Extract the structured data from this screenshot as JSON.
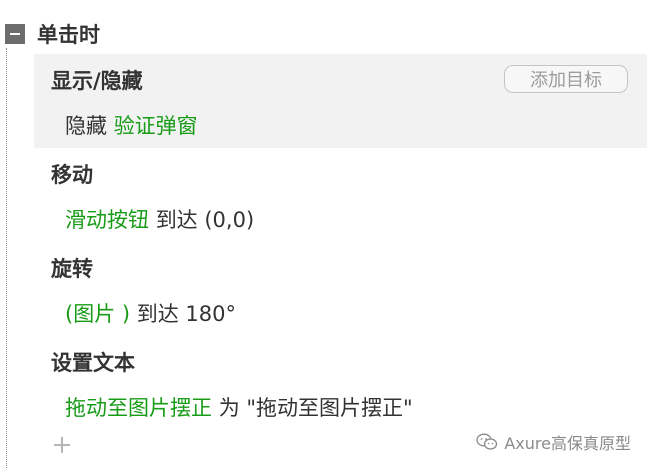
{
  "event": {
    "title": "单击时",
    "collapse_icon": "minus-square-icon"
  },
  "actions": [
    {
      "title": "显示/隐藏",
      "add_target_label": "添加目标",
      "detail": {
        "verb": "隐藏",
        "target": "验证弹窗"
      }
    },
    {
      "title": "移动",
      "detail": {
        "target": "滑动按钮",
        "rest": "到达 (0,0)"
      }
    },
    {
      "title": "旋转",
      "detail": {
        "target": "(图片 )",
        "rest": "到达 180°"
      }
    },
    {
      "title": "设置文本",
      "detail": {
        "target": "拖动至图片摆正",
        "rest": "为 \"拖动至图片摆正\""
      }
    }
  ],
  "add_action_icon": "plus-icon",
  "watermark": {
    "text": "Axure高保真原型",
    "icon": "wechat-icon"
  },
  "colors": {
    "target_text": "#189c18",
    "selected_bg": "#f2f2f2",
    "collapse_box": "#6d6d6d"
  }
}
